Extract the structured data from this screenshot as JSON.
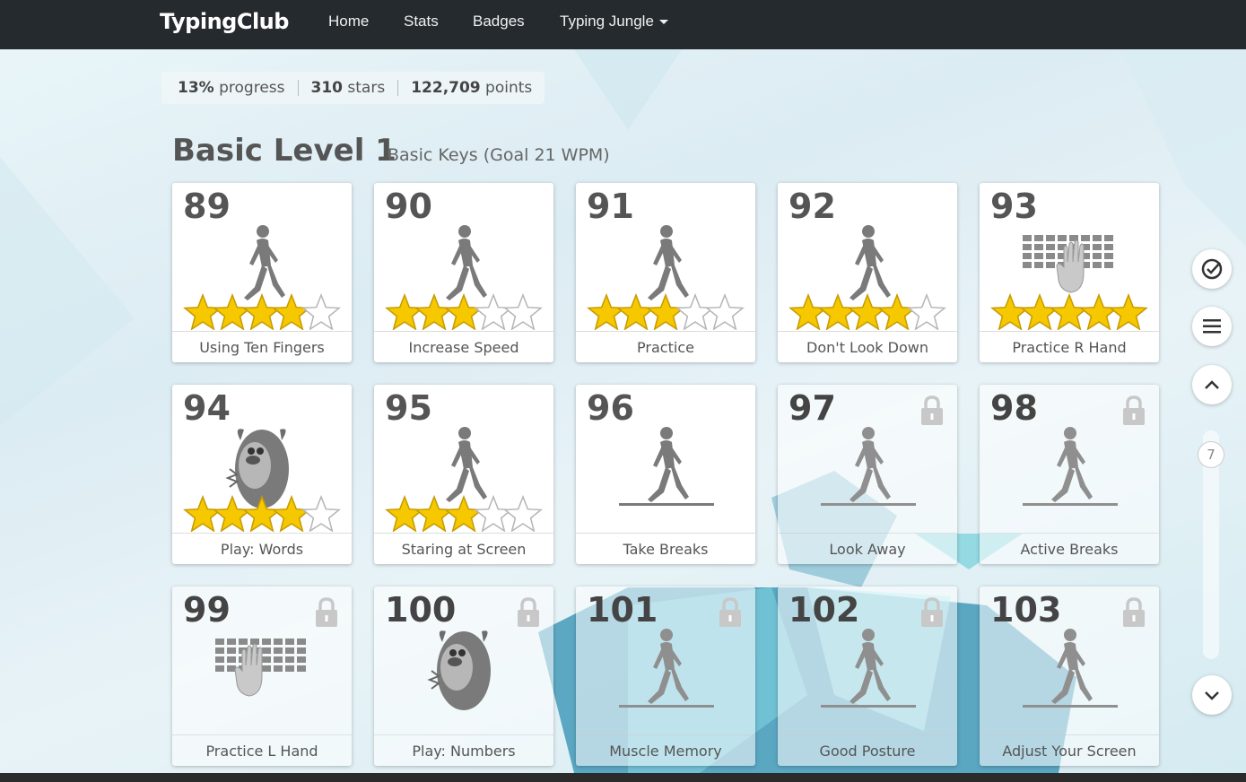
{
  "nav": {
    "brand": "TypingClub",
    "links": [
      "Home",
      "Stats",
      "Badges",
      "Typing Jungle"
    ]
  },
  "progress": {
    "percent": "13%",
    "percent_label": "progress",
    "stars": "310",
    "stars_label": "stars",
    "points": "122,709",
    "points_label": "points"
  },
  "level": {
    "title": "Basic Level 1",
    "subtitle": "Basic Keys (Goal 21 WPM)"
  },
  "lessons": [
    {
      "num": "89",
      "label": "Using Ten Fingers",
      "icon": "walking-person-icon",
      "stars": 4,
      "locked": false
    },
    {
      "num": "90",
      "label": "Increase Speed",
      "icon": "walking-person-icon",
      "stars": 3,
      "locked": false
    },
    {
      "num": "91",
      "label": "Practice",
      "icon": "walking-person-icon",
      "stars": 3,
      "locked": false
    },
    {
      "num": "92",
      "label": "Don't Look Down",
      "icon": "walking-person-icon",
      "stars": 4,
      "locked": false
    },
    {
      "num": "93",
      "label": "Practice R Hand",
      "icon": "keyboard-right-hand-icon",
      "stars": 5,
      "locked": false
    },
    {
      "num": "94",
      "label": "Play: Words",
      "icon": "monster-game-icon",
      "stars": 4,
      "locked": false
    },
    {
      "num": "95",
      "label": "Staring at Screen",
      "icon": "walking-person-icon",
      "stars": 3,
      "locked": false
    },
    {
      "num": "96",
      "label": "Take Breaks",
      "icon": "walking-person-icon",
      "stars": 0,
      "locked": false
    },
    {
      "num": "97",
      "label": "Look Away",
      "icon": "walking-person-icon",
      "stars": 0,
      "locked": true
    },
    {
      "num": "98",
      "label": "Active Breaks",
      "icon": "walking-person-icon",
      "stars": 0,
      "locked": true
    },
    {
      "num": "99",
      "label": "Practice L Hand",
      "icon": "keyboard-left-hand-icon",
      "stars": 0,
      "locked": true
    },
    {
      "num": "100",
      "label": "Play: Numbers",
      "icon": "monster-game-icon",
      "stars": 0,
      "locked": true
    },
    {
      "num": "101",
      "label": "Muscle Memory",
      "icon": "walking-person-icon",
      "stars": 0,
      "locked": true
    },
    {
      "num": "102",
      "label": "Good Posture",
      "icon": "walking-person-icon",
      "stars": 0,
      "locked": true
    },
    {
      "num": "103",
      "label": "Adjust Your Screen",
      "icon": "walking-person-icon",
      "stars": 0,
      "locked": true
    }
  ],
  "side": {
    "slider_value": "7",
    "icons": [
      "check-circle-icon",
      "menu-icon",
      "chevron-up-icon",
      "chevron-down-icon"
    ]
  },
  "colors": {
    "nav_bg": "#252a2f",
    "star_gold": "#f5c800",
    "icon_gray": "#7a7a7a"
  }
}
